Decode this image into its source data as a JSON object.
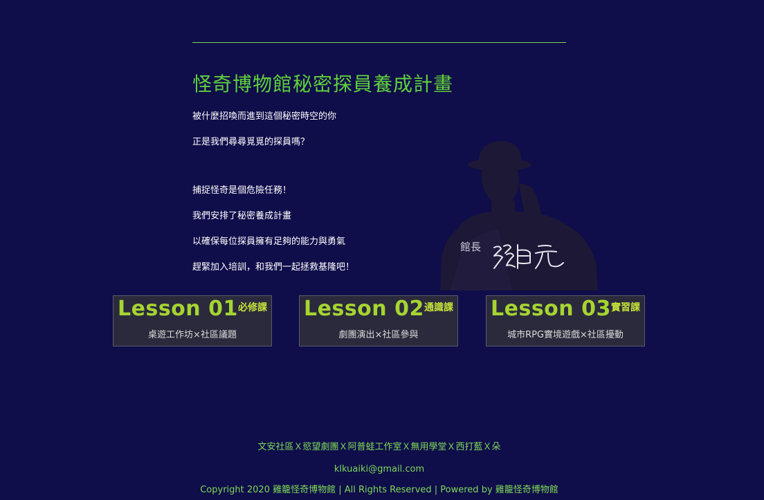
{
  "main": {
    "title": "怪奇博物館秘密探員養成計畫",
    "intro": [
      "被什麼招喚而進到這個秘密時空的你",
      "正是我們尋尋覓覓的探員嗎？",
      "捕捉怪奇是個危險任務！",
      "我們安排了秘密養成計畫",
      "以確保每位探員擁有足夠的能力與勇氣",
      "趕緊加入培訓，和我們一起拯救基隆吧！"
    ],
    "curator_label": "館長",
    "signature_text": "張中元"
  },
  "lessons": [
    {
      "title": "Lesson 01",
      "badge": "必修課",
      "subtitle": "桌遊工作坊×社區議題"
    },
    {
      "title": "Lesson 02",
      "badge": "通識課",
      "subtitle": "劇團演出×社區參與"
    },
    {
      "title": "Lesson 03",
      "badge": "實習課",
      "subtitle": "城市RPG實境遊戲×社區擾動"
    }
  ],
  "footer": {
    "partners": "文安社區Ｘ慾望劇團Ｘ阿普蛙工作室Ｘ無用學堂Ｘ西打藍Ｘ朵",
    "email": "klkuaiki@gmail.com",
    "copyright": "Copyright 2020 雞籠怪奇博物館 | All Rights Reserved | Powered by 雞籠怪奇博物館"
  },
  "colors": {
    "background": "#0f0d4a",
    "accent_green": "#5fd13b",
    "lesson_title": "#a6d431",
    "card_bg": "#2a2a3c"
  }
}
